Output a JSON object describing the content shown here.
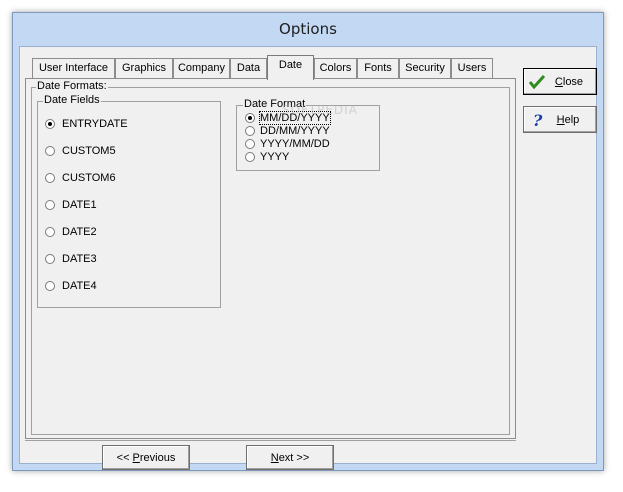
{
  "window": {
    "title": "Options"
  },
  "tabs": [
    {
      "label": "User Interface"
    },
    {
      "label": "Graphics"
    },
    {
      "label": "Company"
    },
    {
      "label": "Data"
    },
    {
      "label": "Date",
      "active": true
    },
    {
      "label": "Colors"
    },
    {
      "label": "Fonts"
    },
    {
      "label": "Security"
    },
    {
      "label": "Users"
    }
  ],
  "date_formats_group": {
    "label": "Date Formats:"
  },
  "date_fields": {
    "label": "Date Fields",
    "options": [
      "ENTRYDATE",
      "CUSTOM5",
      "CUSTOM6",
      "DATE1",
      "DATE2",
      "DATE3",
      "DATE4"
    ],
    "selected": "ENTRYDATE"
  },
  "date_format": {
    "label": "Date Format",
    "options": [
      "MM/DD/YYYY",
      "DD/MM/YYYY",
      "YYYY/MM/DD",
      "YYYY"
    ],
    "selected": "MM/DD/YYYY"
  },
  "buttons": {
    "close_key": "C",
    "close_rest": "lose",
    "help_key": "H",
    "help_rest": "elp",
    "previous_prefix": "<< ",
    "previous_key": "P",
    "previous_rest": "revious",
    "next_key": "N",
    "next_rest": "ext >>"
  },
  "watermark": {
    "text": "SOFTPEDIA"
  },
  "colors": {
    "close_check": "#2e8b1f",
    "help_question": "#1e3fa8"
  }
}
